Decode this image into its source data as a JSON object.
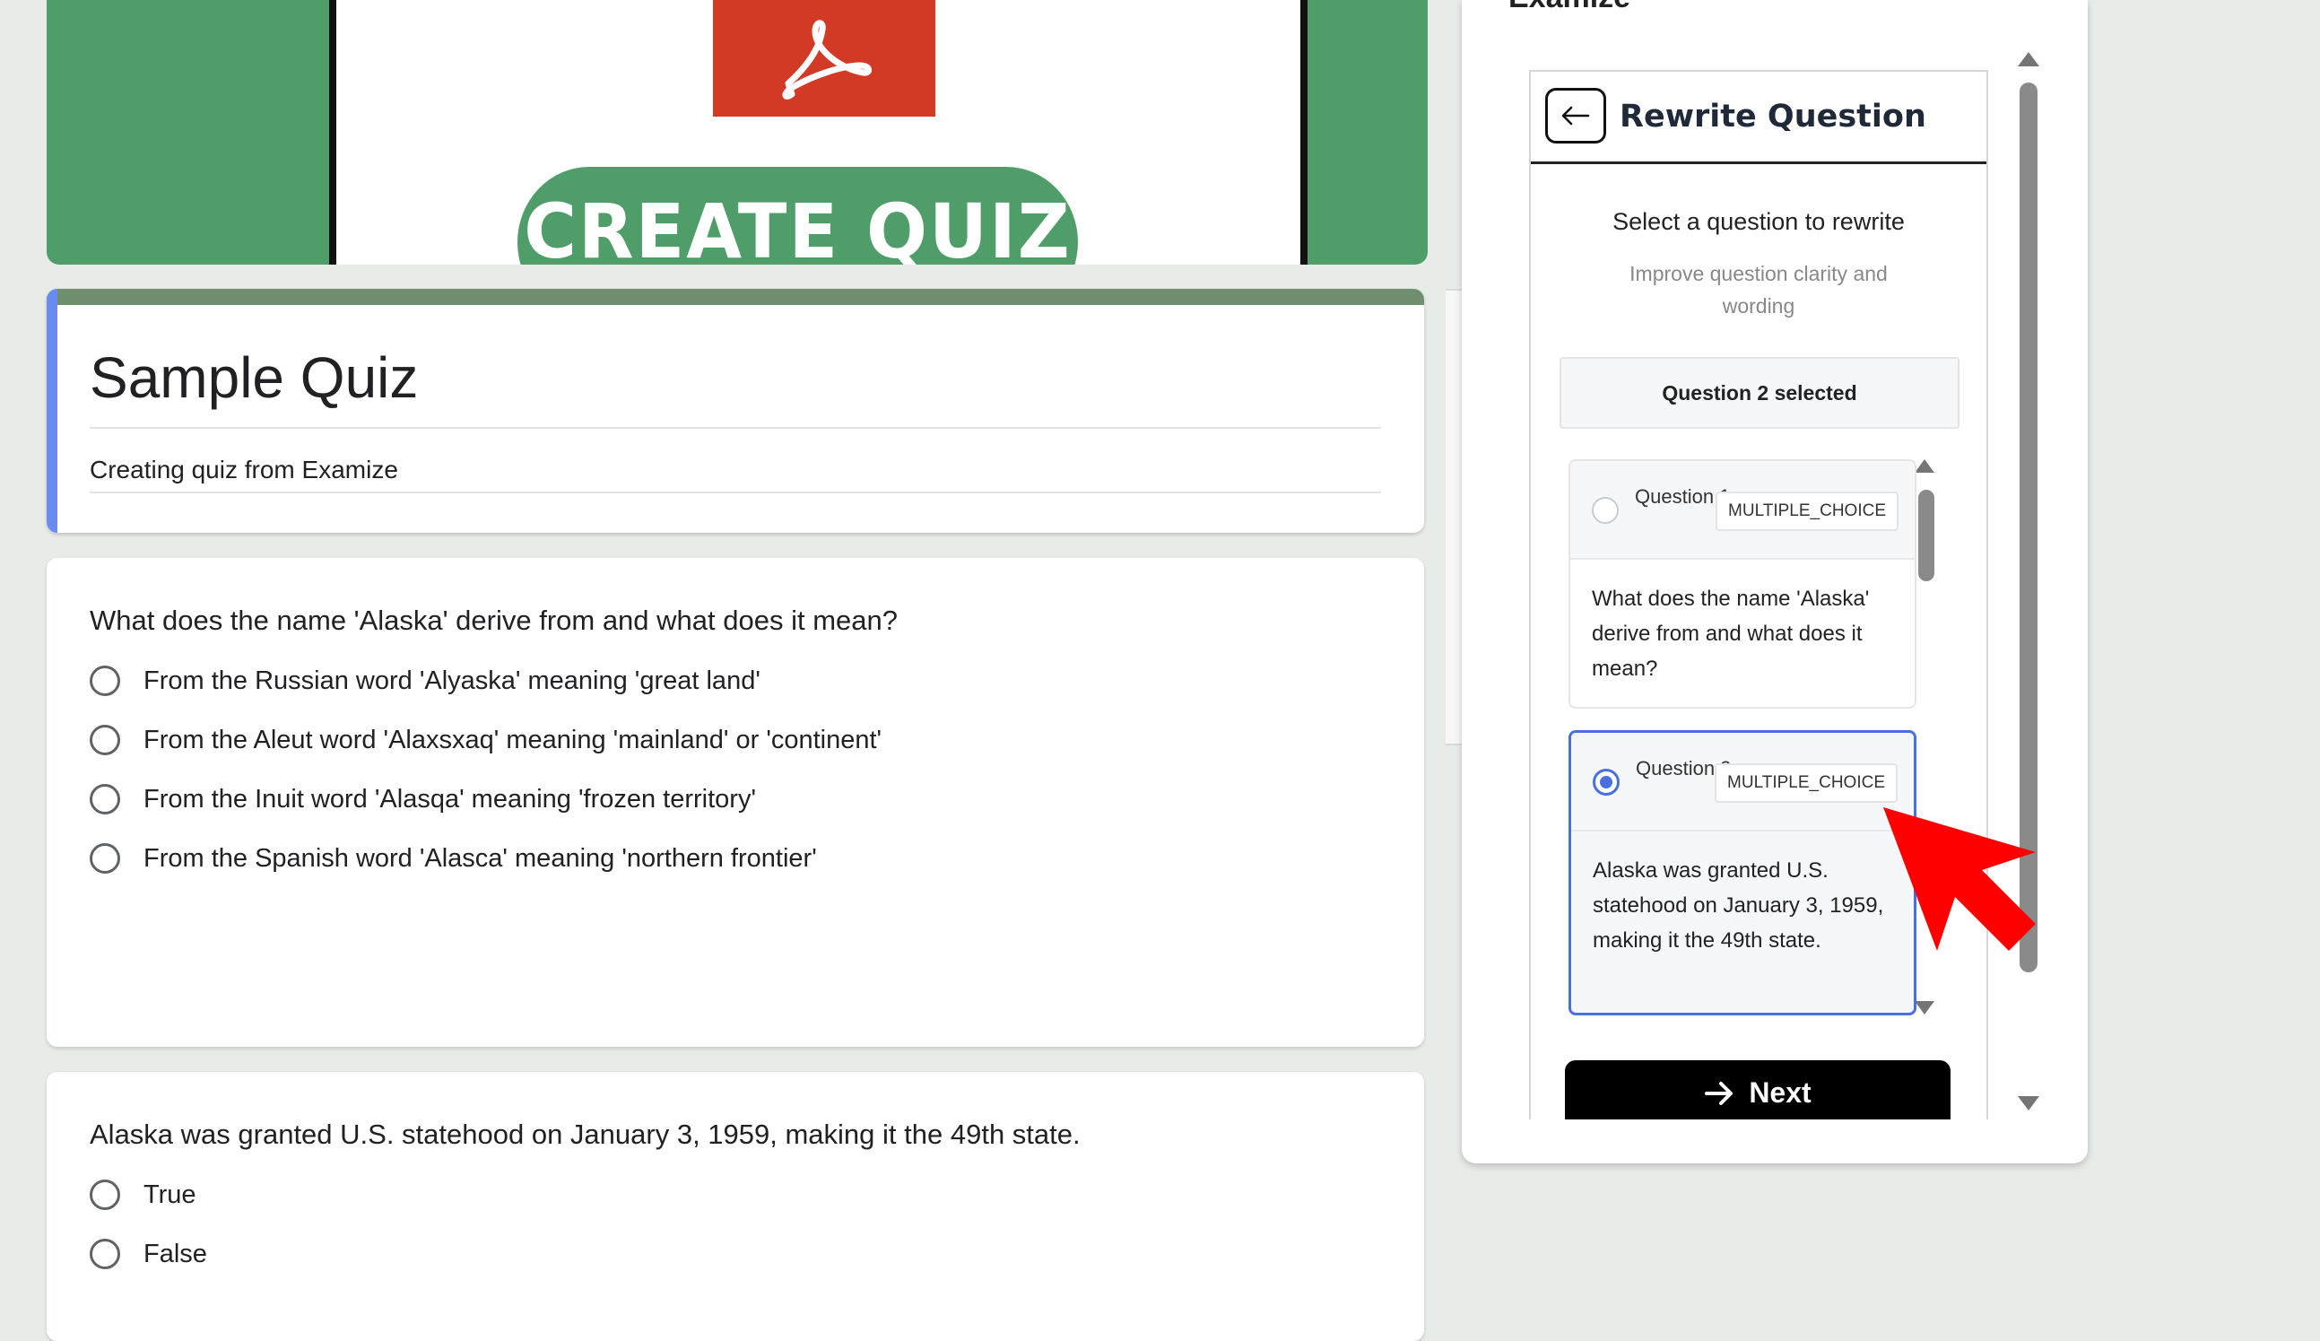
{
  "banner": {
    "cta_text": "CREATE QUIZ",
    "logo_icon": "acrobat-pdf-icon",
    "colors": {
      "background": "#4f9e6a",
      "logo": "#d23a26"
    }
  },
  "form": {
    "title": "Sample Quiz",
    "description": "Creating quiz from Examize",
    "accent_color": "#6b8cef"
  },
  "questions": [
    {
      "text": "What does the name 'Alaska' derive from and what does it mean?",
      "options": [
        "From the Russian word 'Alyaska' meaning 'great land'",
        "From the Aleut word 'Alaxsxaq' meaning 'mainland' or 'continent'",
        "From the Inuit word 'Alasqa' meaning 'frozen territory'",
        "From the Spanish word 'Alasca' meaning 'northern frontier'"
      ]
    },
    {
      "text": "Alaska was granted U.S. statehood on January 3, 1959, making it the 49th state.",
      "options": [
        "True",
        "False"
      ]
    }
  ],
  "side_panel": {
    "heading": "Examize",
    "title": "Rewrite Question",
    "back_icon": "arrow-left-icon",
    "select_label": "Select a question to rewrite",
    "select_sub": "Improve question clarity and wording",
    "selected_status": "Question 2 selected",
    "items": [
      {
        "label": "Question 1",
        "type": "MULTIPLE_CHOICE",
        "text": "What does the name 'Alaska' derive from and what does it mean?",
        "selected": false
      },
      {
        "label": "Question 2",
        "type": "MULTIPLE_CHOICE",
        "text": "Alaska was granted U.S. statehood on January 3, 1959, making it the 49th state.",
        "selected": true
      }
    ],
    "next_label": "Next",
    "next_icon": "arrow-right-icon",
    "selection_color": "#4a6fe0"
  }
}
